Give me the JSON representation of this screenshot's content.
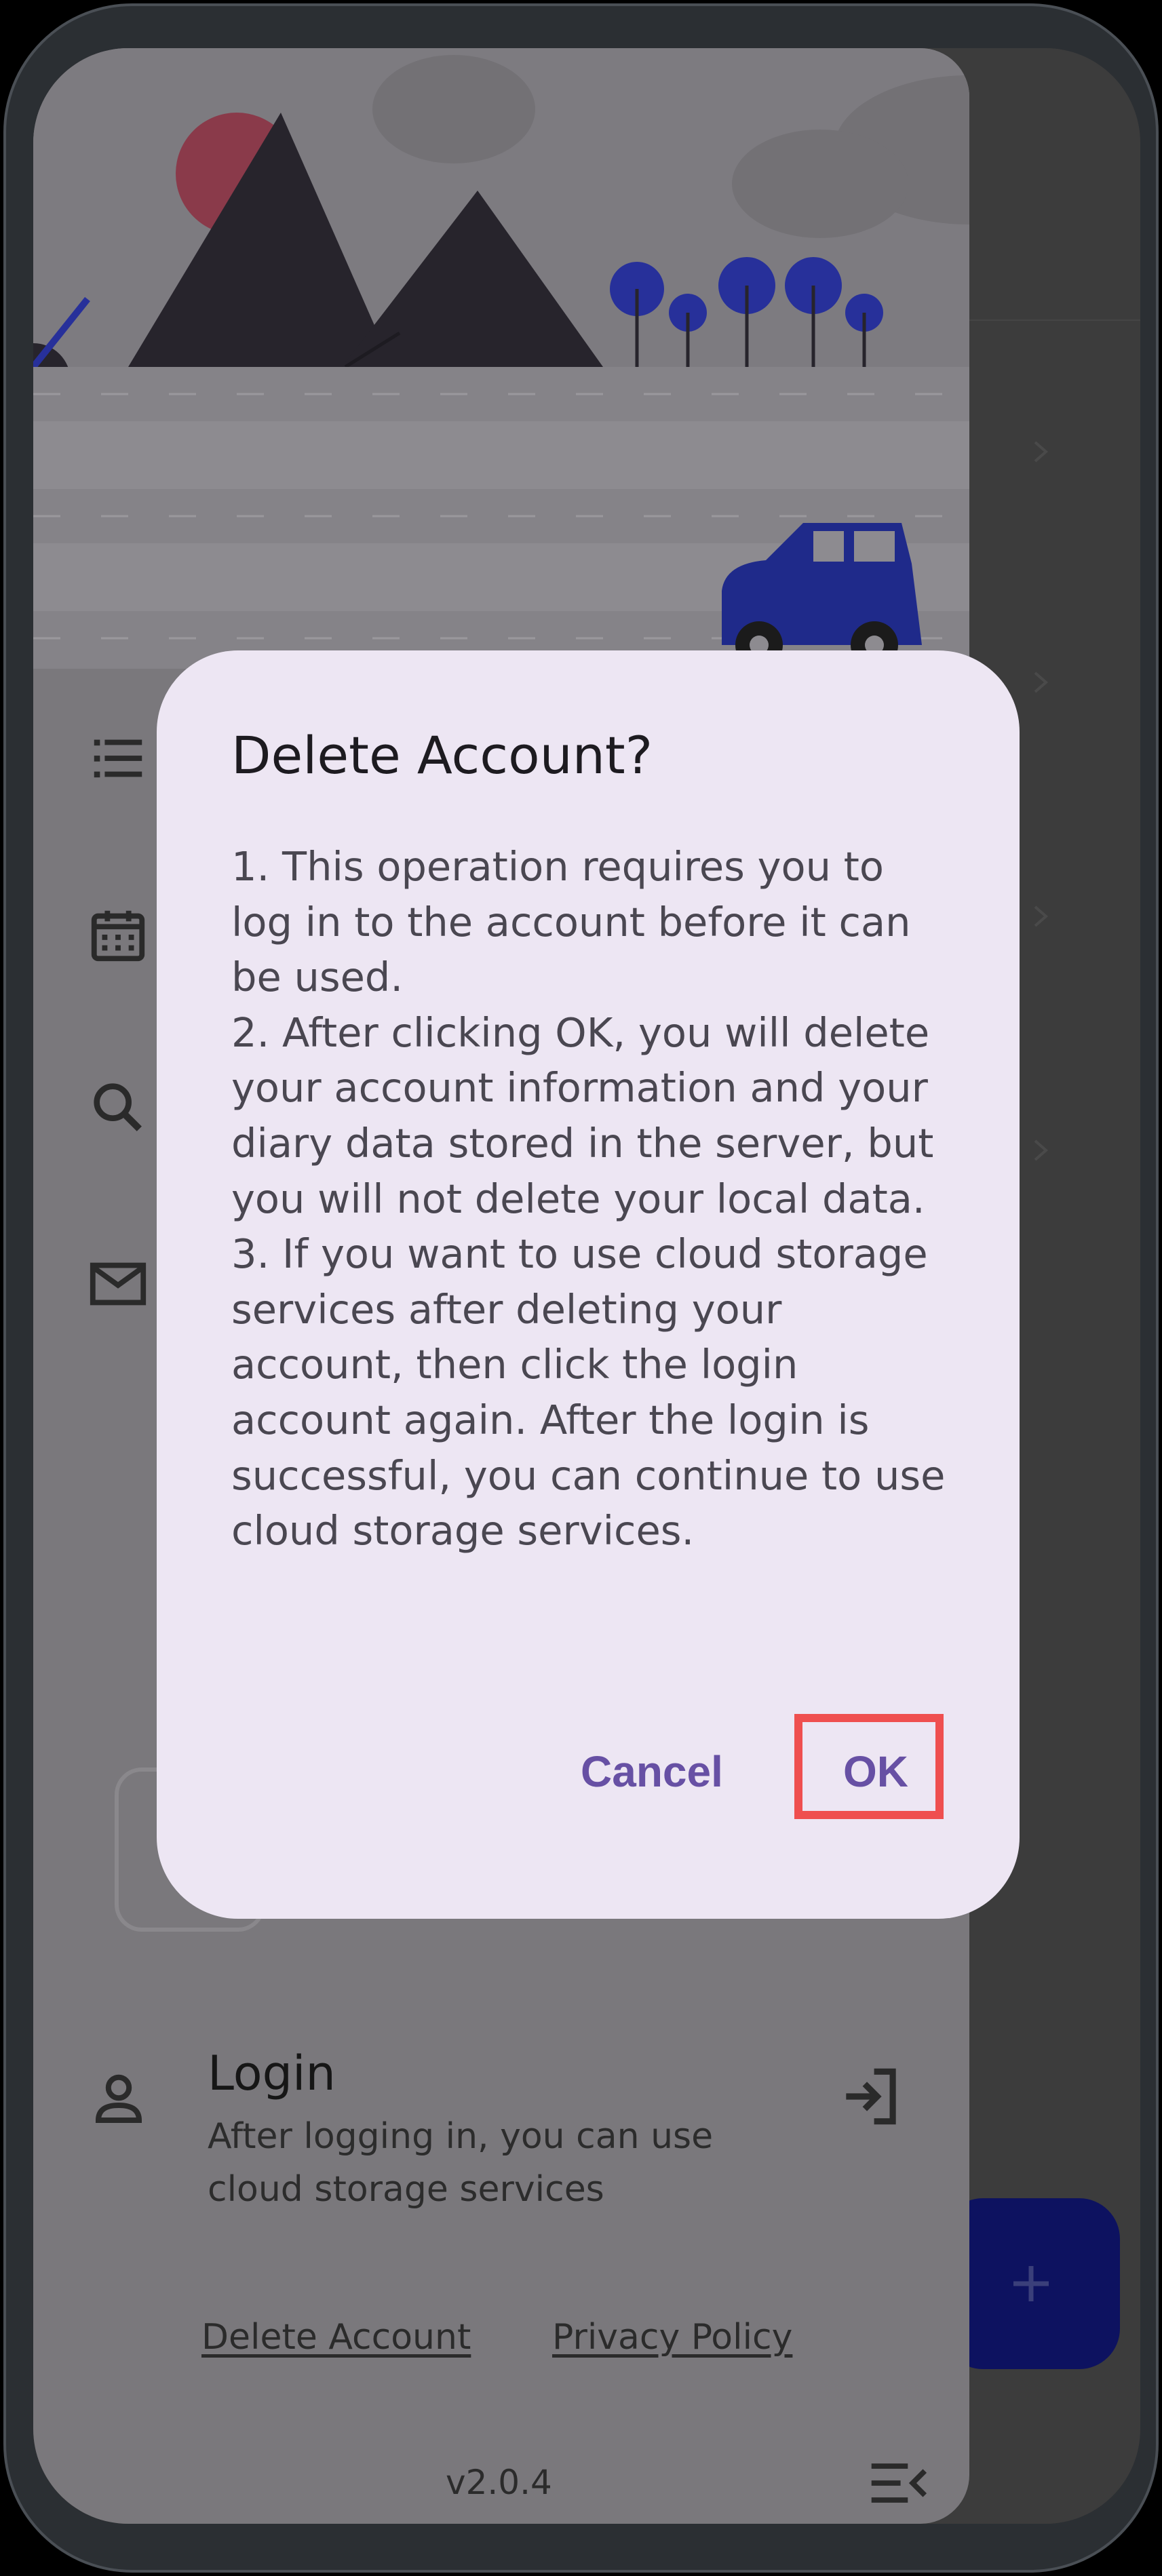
{
  "drawer": {
    "nav_items": [
      {
        "icon": "list-icon"
      },
      {
        "icon": "calendar-icon"
      },
      {
        "icon": "search-icon"
      },
      {
        "icon": "mail-icon"
      }
    ],
    "login": {
      "title": "Login",
      "description": "After logging in, you can use cloud storage services",
      "icon": "person-icon",
      "action_icon": "login-arrow-icon"
    },
    "links": {
      "delete_account": "Delete Account",
      "privacy_policy": "Privacy Policy"
    },
    "version": "v2.0.4",
    "collapse_icon": "menu-collapse-icon"
  },
  "fab": {
    "icon": "plus-icon"
  },
  "dialog": {
    "title": "Delete Account?",
    "body": "1. This operation requires you to log in to the account before it can be used.\n2. After clicking OK, you will delete your account information and your diary data stored in the server, but you will not delete your local data.\n3. If you want to use cloud storage services after deleting your account, then click the login account again. After the login is successful, you can continue to use cloud storage services.",
    "cancel_label": "Cancel",
    "ok_label": "OK"
  },
  "colors": {
    "dialog_bg": "#ede6f3",
    "button_text": "#6750a4",
    "highlight_frame": "#ef4f4f",
    "fab_bg": "#0d1260",
    "car": "#1f2a8a"
  }
}
